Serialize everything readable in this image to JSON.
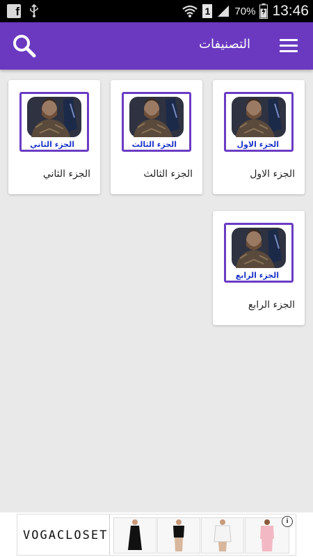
{
  "status_bar": {
    "sim_number": "1",
    "battery_percent": "70%",
    "time": "13:46"
  },
  "app_bar": {
    "title": "التصنيفات"
  },
  "categories": [
    {
      "label": "الجزء الاول",
      "thumb_caption": "الجزء الاول"
    },
    {
      "label": "الجزء الثالث",
      "thumb_caption": "الجزء الثالث"
    },
    {
      "label": "الجزء الثاني",
      "thumb_caption": "الجزء الثاني"
    },
    {
      "label": "الجزء الرابع",
      "thumb_caption": "الجزء الرابع"
    }
  ],
  "ad": {
    "brand": "VOGACLOSET",
    "info_icon": "i"
  },
  "colors": {
    "primary": "#6a39c0",
    "thumb_border": "#6a3cc4",
    "caption": "#1b33c9",
    "background": "#e9e9e9"
  }
}
